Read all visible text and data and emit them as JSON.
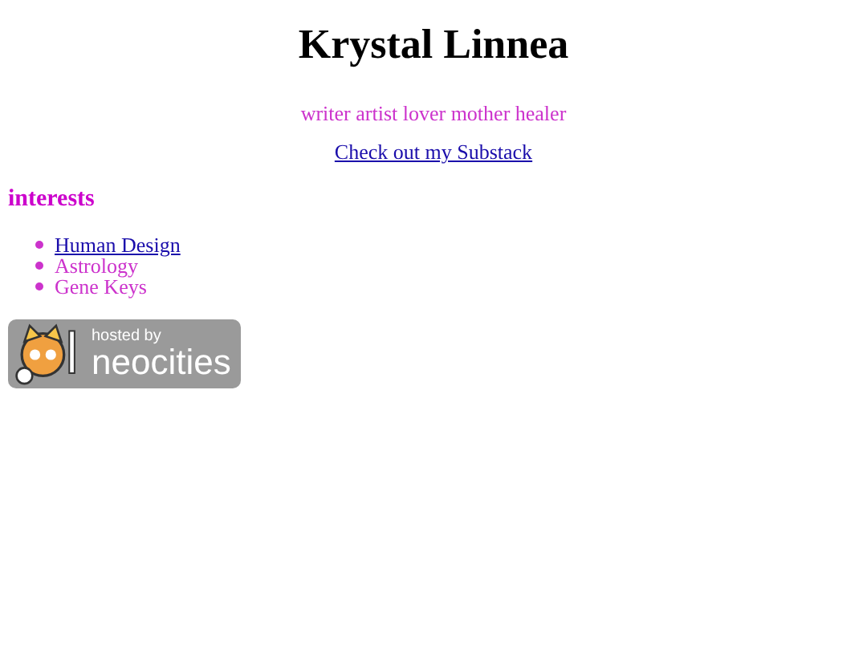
{
  "header": {
    "title": "Krystal Linnea",
    "tagline": "writer artist lover mother healer",
    "link": "Check out my Substack"
  },
  "interests": {
    "heading": "interests",
    "items": [
      {
        "label": "Human Design",
        "kind": "link"
      },
      {
        "label": "Astrology",
        "kind": "text"
      },
      {
        "label": "Gene Keys",
        "kind": "text"
      }
    ]
  },
  "badge": {
    "line_1": "hosted by",
    "line_2": "neocities"
  }
}
